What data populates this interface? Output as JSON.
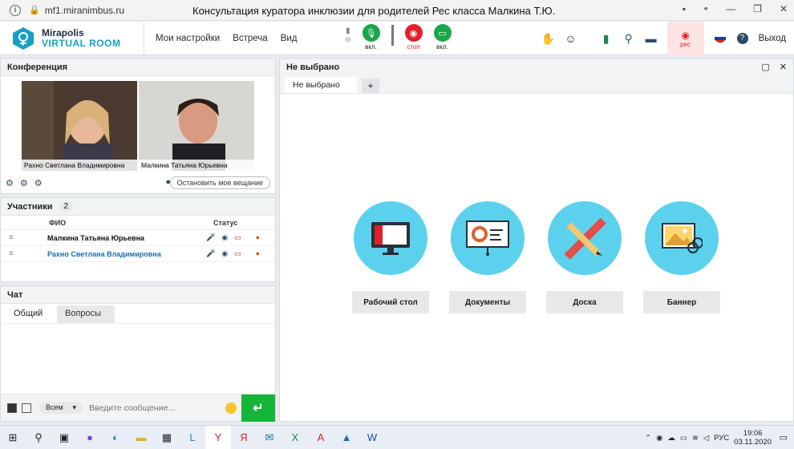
{
  "browser": {
    "url": "mf1.miranimbus.ru",
    "title": "Консультация куратора инклюзии для родителей Рес класса Малкина Т.Ю."
  },
  "app": {
    "logo_line1": "Mirapolis",
    "logo_line2": "VIRTUAL ROOM",
    "menu": [
      "Мои настройки",
      "Встреча",
      "Вид"
    ],
    "mic_caption": "вкл.",
    "cam_caption": "стоп",
    "screen_caption": "вкл.",
    "rec_label": "рес",
    "exit_label": "Выход"
  },
  "conference": {
    "title": "Конференция",
    "videos": [
      {
        "name": "Рахно Светлана  Владимировна"
      },
      {
        "name": "Малкина Татьяна  Юрьевна"
      }
    ],
    "stop_button": "Остановить мое вещание"
  },
  "participants": {
    "title": "Участники",
    "count": "2",
    "col_name": "ФИО",
    "col_status": "Статус",
    "rows": [
      {
        "name": "Малкина Татьяна  Юрьевна",
        "color": "#111111"
      },
      {
        "name": "Рахно Светлана  Владимировна",
        "color": "#1a6fa8"
      }
    ]
  },
  "chat": {
    "title": "Чат",
    "tabs": [
      "Общий",
      "Вопросы"
    ],
    "recipient": "Всем",
    "placeholder": "Введите сообщение..."
  },
  "workspace": {
    "title": "Не выбрано",
    "tab": "Не выбрано",
    "tools": [
      "Рабочий стол",
      "Документы",
      "Доска",
      "Баннер"
    ]
  },
  "taskbar": {
    "lang": "РУС",
    "time": "19:06",
    "date": "03.11.2020"
  },
  "colors": {
    "accent": "#17a0c7",
    "tool_circle": "#5cd1ee",
    "send": "#15b53a",
    "mic_on": "#1aa64a",
    "cam_stop": "#e0202a"
  }
}
